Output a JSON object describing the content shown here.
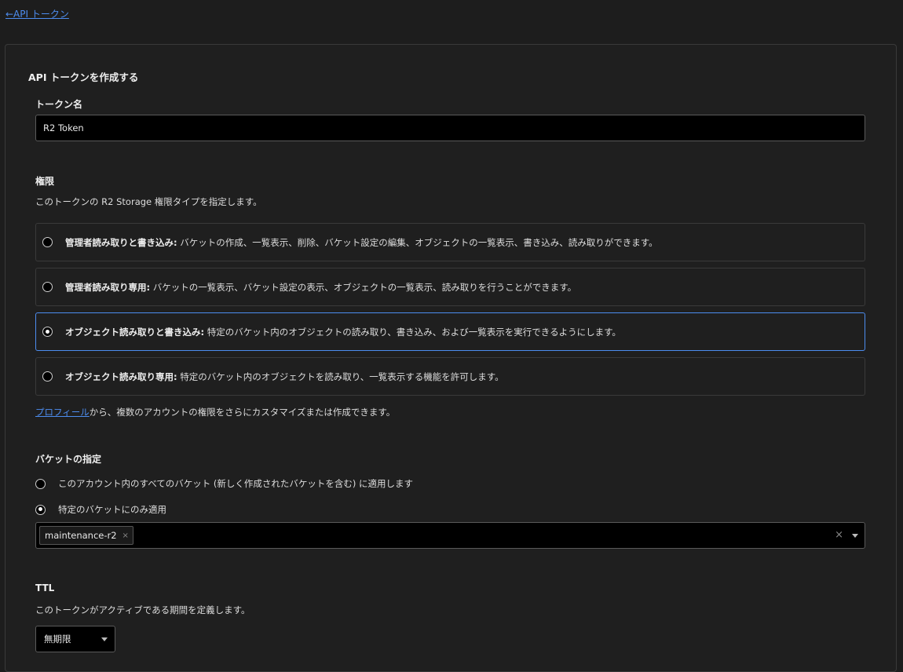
{
  "nav": {
    "back_label": "←API トークン"
  },
  "card": {
    "title": "API トークンを作成する"
  },
  "token_name": {
    "label": "トークン名",
    "value": "R2 Token"
  },
  "permissions": {
    "label": "権限",
    "description": "このトークンの R2 Storage 権限タイプを指定します。",
    "options": [
      {
        "title": "管理者読み取りと書き込み:",
        "description": " バケットの作成、一覧表示、削除、バケット設定の編集、オブジェクトの一覧表示、書き込み、読み取りができます。",
        "selected": false
      },
      {
        "title": "管理者読み取り専用:",
        "description": " バケットの一覧表示、バケット設定の表示、オブジェクトの一覧表示、読み取りを行うことができます。",
        "selected": false
      },
      {
        "title": "オブジェクト読み取りと書き込み:",
        "description": " 特定のバケット内のオブジェクトの読み取り、書き込み、および一覧表示を実行できるようにします。",
        "selected": true
      },
      {
        "title": "オブジェクト読み取り専用:",
        "description": " 特定のバケット内のオブジェクトを読み取り、一覧表示する機能を許可します。",
        "selected": false
      }
    ],
    "profile_link": "プロフィール",
    "profile_note": "から、複数のアカウントの権限をさらにカスタマイズまたは作成できます。"
  },
  "buckets": {
    "label": "バケットの指定",
    "options": [
      {
        "label": "このアカウント内のすべてのバケット (新しく作成されたバケットを含む) に適用します",
        "selected": false
      },
      {
        "label": "特定のバケットにのみ適用",
        "selected": true
      }
    ],
    "selected_tags": [
      "maintenance-r2"
    ],
    "tag_remove_glyph": "×",
    "clear_glyph": "×"
  },
  "ttl": {
    "label": "TTL",
    "description": "このトークンがアクティブである期間を定義します。",
    "value": "無期限"
  }
}
